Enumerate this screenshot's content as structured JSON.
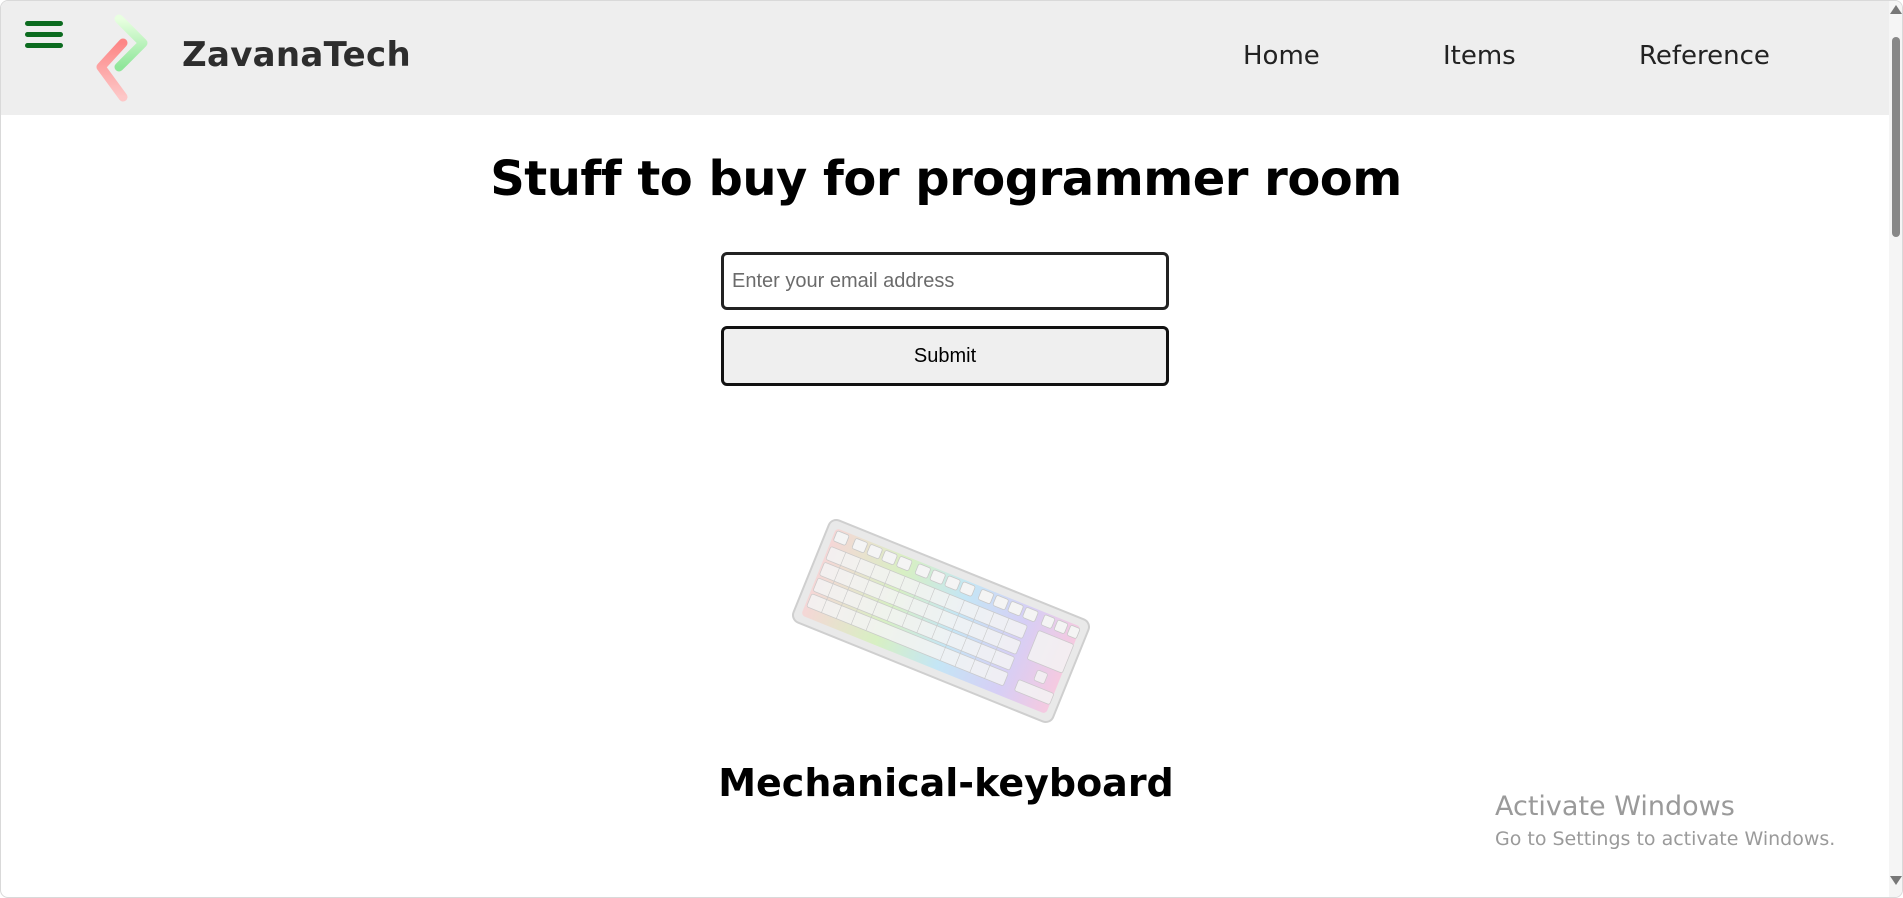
{
  "header": {
    "brand": "ZavanaTech",
    "nav": {
      "home": "Home",
      "items": "Items",
      "reference": "Reference"
    },
    "menu_icon": "hamburger-menu-icon",
    "logo_icon": "zavanatech-logo-icon",
    "colors": {
      "background": "#eeeeee",
      "menu_icon": "#0b6b1f",
      "logo_left": "#ff8a8a",
      "logo_right": "#b8f5a8"
    }
  },
  "main": {
    "title": "Stuff to buy for programmer room",
    "email_placeholder": "Enter your email address",
    "submit_label": "Submit",
    "product": {
      "name": "Mechanical-keyboard",
      "image_icon": "mechanical-keyboard-image"
    }
  },
  "watermark": {
    "title": "Activate Windows",
    "subtitle": "Go to Settings to activate Windows."
  }
}
